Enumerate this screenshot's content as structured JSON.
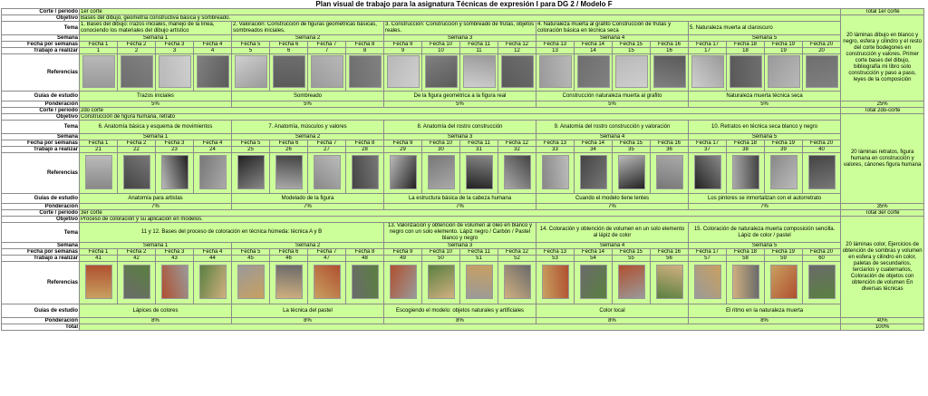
{
  "title": "Plan visual de trabajo para la asignatura Técnicas de expresión I para DG 2 / Modelo F",
  "labels": {
    "corte": "Corte / período",
    "objetivo": "Objetivo",
    "tema": "Tema",
    "semana": "Semana",
    "fecha": "Fecha por semanas",
    "trabajo": "Trabajo a realizar",
    "referencias": "Referencias",
    "guias": "Guías de estudio",
    "ponderacion": "Ponderación",
    "total": "Total"
  },
  "blocks": [
    {
      "corte": "1er corte",
      "total_label": "Total 1er corte",
      "objetivo": "Bases del dibujo, geometría constructiva básica y sombreado.",
      "side": "20 láminas dibujo en blanco y negro, esfera y cilindro y el resto del corte bodegones en construcción y valores. Primer corte bases del dibujo, bibliografía mi libro solo construcción y paso a paso, leyes de la composición",
      "temas": [
        "1. Bases del dibujo:Trazos iniciales, manejo de la línea, conociendo los materiales del dibujo artístico",
        "2. Valoración: Construcción de figuras geométricas básicas, sombreados iniciales.",
        "3. Construcción: Construcción y sombreado de frutas, objetos reales.",
        "4. Naturaleza muerta al grafito Construcción de frutas y coloración básica en técnica seca",
        "5. Naturaleza muerta al claroscuro"
      ],
      "semanas": [
        "Semana 1",
        "Semana 2",
        "Semana 3",
        "Semana 4",
        "Semana 5"
      ],
      "trabajos": [
        "1",
        "2",
        "3",
        "4",
        "5",
        "6",
        "7",
        "8",
        "9",
        "10",
        "11",
        "12",
        "13",
        "14",
        "15",
        "16",
        "17",
        "18",
        "19",
        "20"
      ],
      "guias": [
        "Trazos iniciales",
        "Sombreado",
        "De la figura geométrica a la figura real",
        "Construcción naturaleza muerta al grafito",
        "Naturaleza muerta técnica seca"
      ],
      "pond": [
        "5%",
        "5%",
        "5%",
        "5%",
        "5%"
      ],
      "total_pond": "25%"
    },
    {
      "corte": "2do corte",
      "total_label": "Total 2do-corte",
      "objetivo": "Construcción de figura humana, retrato",
      "side": "20 láminas retratos, figura humana en construcción y valores, cánones figura humana",
      "temas": [
        "6. Anatomía básica y esquema de movimientos",
        "7. Anatomía, músculos y valores",
        "8. Anatomía del rostro construcción",
        "9. Anatomía del rostro construcción y valoración",
        "10. Retratos en técnica seca blanco y negro"
      ],
      "semanas": [
        "Semana 1",
        "Semana 2",
        "Semana 3",
        "Semana 4",
        "Semana 5"
      ],
      "trabajos": [
        "21",
        "22",
        "23",
        "24",
        "25",
        "26",
        "27",
        "28",
        "29",
        "30",
        "31",
        "32",
        "33",
        "34",
        "35",
        "36",
        "37",
        "38",
        "39",
        "40"
      ],
      "guias": [
        "Anatomía para artistas",
        "Modelado de la figura",
        "La estructura básica de la cabeza humana",
        "Cuando el modelo tiene lentes",
        "Los pintores se inmortalizan con el autorretrato"
      ],
      "pond": [
        "7%",
        "7%",
        "7%",
        "7%",
        "7%"
      ],
      "total_pond": "35%"
    },
    {
      "corte": "3er corte",
      "total_label": "Total 3er corte",
      "objetivo": "Proceso de coloración y su aplicación en modelos.",
      "side": "20 láminas color, Ejercicios de obtención de sombras y volumen en esfera y cilindro en color, paletas de secundarios, terciarios y cuaternarios, Coloración de objetos con obtención de volumen En diversas técnicas",
      "temas": [
        "11 y 12. Bases del proceso de coloración en técnica húmeda: técnica A y B",
        "13. Valorización y obtención de volumen al óleo en blanco y negro con un solo elemento. Lápiz negro / Carbón / Pastel blanco y negro",
        "14. Coloración y obtención de volumen en un solo elemento al lápiz de color",
        "15. Coloración de naturaleza muerta composición sencilla. Lápiz de color / pastel"
      ],
      "semanas": [
        "Semana 1",
        "Semana 2",
        "Semana 3",
        "Semana 4",
        "Semana 5"
      ],
      "trabajos": [
        "41",
        "42",
        "43",
        "44",
        "45",
        "46",
        "47",
        "48",
        "49",
        "50",
        "51",
        "52",
        "53",
        "54",
        "55",
        "56",
        "57",
        "58",
        "59",
        "60"
      ],
      "guias": [
        "Lápices de colores",
        "La técnica del pastel",
        "Escogiendo el modelo: objetos naturales y artificiales",
        "Color local",
        "El ritmo en la naturaleza muerta"
      ],
      "pond": [
        "8%",
        "8%",
        "8%",
        "8%",
        "8%"
      ],
      "total_pond": "40%"
    }
  ],
  "fechas": [
    "Fecha 1",
    "Fecha 2",
    "Fecha 3",
    "Fecha 4",
    "Fecha 5",
    "Fecha 6",
    "Fecha 7",
    "Fecha 8",
    "Fecha 9",
    "Fecha 10",
    "Fecha 11",
    "Fecha 12",
    "Fecha 13",
    "Fecha 14",
    "Fecha 15",
    "Fecha 16",
    "Fecha 17",
    "Fecha 18",
    "Fecha 19",
    "Fecha 20"
  ],
  "grand_total": "100%",
  "colors": {
    "green": "#ccff99",
    "white": "#ffffff",
    "border": "#8a8a8a"
  }
}
